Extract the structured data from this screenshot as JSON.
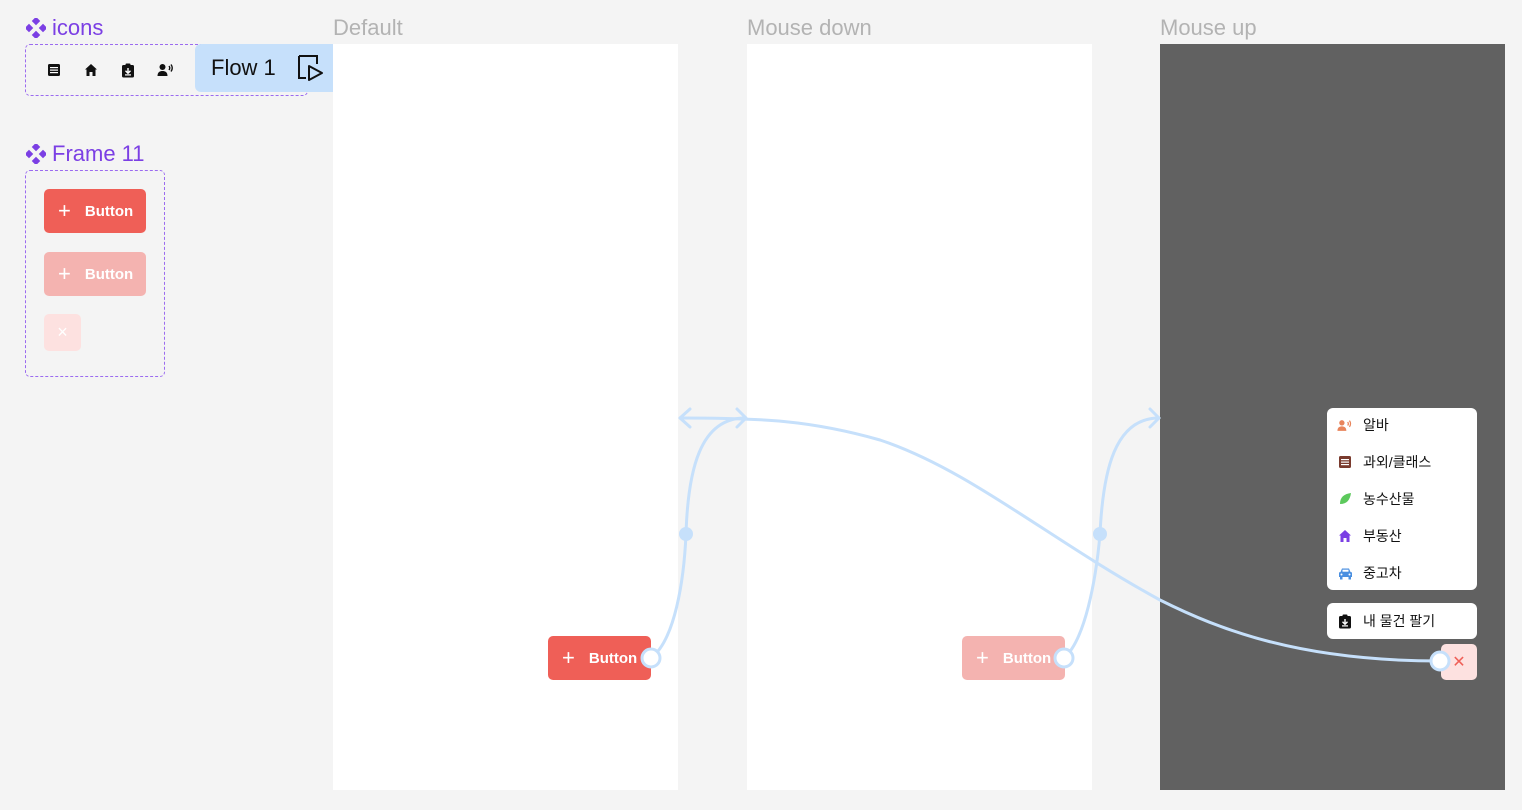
{
  "components": {
    "icons": {
      "title": "icons",
      "icon_names": [
        "list-icon",
        "home-icon",
        "clipboard-download-icon",
        "speaker-person-icon"
      ]
    },
    "frame11": {
      "title": "Frame 11",
      "button_default_label": "Button",
      "button_pressed_label": "Button",
      "close_glyph": "×"
    }
  },
  "flow": {
    "label": "Flow 1",
    "icon": "play-frame-icon"
  },
  "frames": [
    {
      "label": "Default",
      "background": "#ffffff"
    },
    {
      "label": "Mouse down",
      "background": "#ffffff"
    },
    {
      "label": "Mouse up",
      "background": "#616161"
    }
  ],
  "default_frame": {
    "button_label": "Button"
  },
  "mousedown_frame": {
    "button_label": "Button"
  },
  "mouseup_frame": {
    "menu_items": [
      {
        "label": "알바",
        "icon": "speaker-person-icon",
        "color": "#e8845b"
      },
      {
        "label": "과외/클래스",
        "icon": "book-icon",
        "color": "#7a3b2e"
      },
      {
        "label": "농수산물",
        "icon": "leaf-icon",
        "color": "#5cc95c"
      },
      {
        "label": "부동산",
        "icon": "home-icon",
        "color": "#7b3fe4"
      },
      {
        "label": "중고차",
        "icon": "car-icon",
        "color": "#4a8fe0"
      }
    ],
    "sell_item": {
      "label": "내 물건 팔기",
      "icon": "clipboard-download-icon"
    },
    "close_glyph": "✕"
  },
  "colors": {
    "accent_purple": "#7b3fe4",
    "button_red": "#ef5f57",
    "button_red_pressed": "#f4b3b0",
    "close_pink": "#fde1e0",
    "connector_blue": "#c6e0fb",
    "dark_overlay": "#616161"
  }
}
